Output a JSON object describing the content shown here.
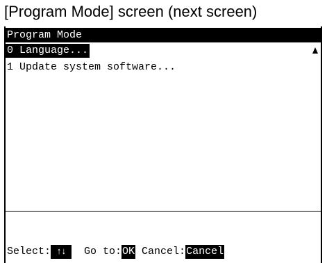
{
  "caption": "[Program Mode] screen (next screen)",
  "screen": {
    "title": "Program Mode",
    "menu_items": [
      {
        "label": "0 Language...",
        "selected": true
      },
      {
        "label": "1 Update system software...",
        "selected": false
      }
    ],
    "scroll_indicator": "up-arrow-icon"
  },
  "footer": {
    "select_label": "Select:",
    "select_key": "↑↓",
    "goto_label": "Go to:",
    "goto_key": "OK",
    "cancel_label": "Cancel:",
    "cancel_key": "Cancel"
  },
  "colors": {
    "highlight_bg": "#000000",
    "highlight_fg": "#ffffff",
    "background": "#ffffff"
  }
}
